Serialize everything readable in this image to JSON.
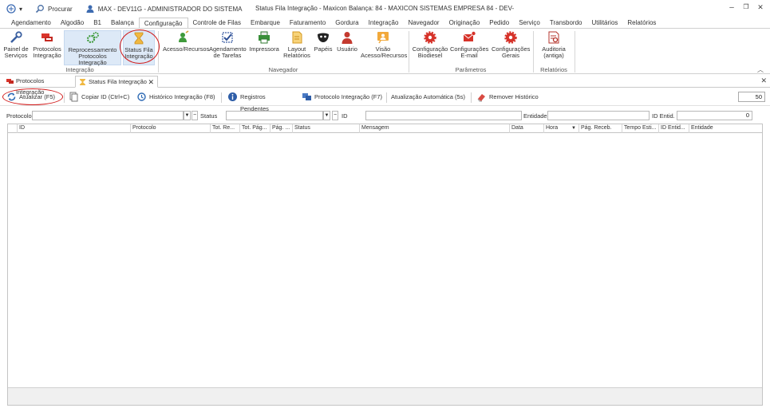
{
  "titlebar": {
    "search_label": "Procurar",
    "user_label": "MAX - DEV11G - ADMINISTRADOR DO SISTEMA",
    "window_title": "Status Fila Integração - Maxicon Balança: 84 - MAXICON SISTEMAS EMPRESA 84 - DEV-",
    "minimize": "–",
    "restore": "❐",
    "close": "✕"
  },
  "menu": {
    "tabs": [
      "Agendamento",
      "Algodão",
      "B1",
      "Balança",
      "Configuração",
      "Controle de Filas",
      "Embarque",
      "Faturamento",
      "Gordura",
      "Integração",
      "Navegador",
      "Originação",
      "Pedido",
      "Serviço",
      "Transbordo",
      "Utilitários",
      "Relatórios"
    ]
  },
  "ribbon": {
    "painel_servicos": [
      "Painel de",
      "Serviços"
    ],
    "protocolos_integracao": [
      "Protocolos",
      "Integração"
    ],
    "reprocessamento": [
      "Reprocessamento",
      "Protocolos Integração"
    ],
    "status_fila": [
      "Status Fila",
      "Integração"
    ],
    "acesso_recursos": [
      "Acesso/Recursos",
      ""
    ],
    "agendamento_tarefas": [
      "Agendamento",
      "de Tarefas"
    ],
    "impressora": [
      "Impressora",
      ""
    ],
    "layout_relatorios": [
      "Layout",
      "Relatórios"
    ],
    "papeis": [
      "Papéis",
      ""
    ],
    "usuario": [
      "Usuário",
      ""
    ],
    "visao_acesso": [
      "Visão",
      "Acesso/Recursos"
    ],
    "config_biodiesel": [
      "Configuração",
      "Biodiesel"
    ],
    "config_email": [
      "Configurações",
      "E-mail"
    ],
    "config_gerais": [
      "Configurações",
      "Gerais"
    ],
    "auditoria": [
      "Auditoria",
      "(antiga)"
    ],
    "groups": {
      "integracao": "Integração",
      "navegador": "Navegador",
      "parametros": "Parâmetros",
      "relatorios": "Relatórios"
    }
  },
  "doctabs": {
    "tab1": "Protocolos Integração",
    "tab2": "Status Fila Integração",
    "close": "✕"
  },
  "toolbar": {
    "atualizar": "Atualizar (F5)",
    "copiar_id": "Copiar ID (Ctrl+C)",
    "historico": "Histórico Integração (F8)",
    "registros_pendentes": "Registros Pendentes",
    "protocolo_integracao": "Protocolo Integração (F7)",
    "atualizacao_automatica": "Atualização Automática (5s)",
    "remover_historico": "Remover Histórico",
    "limit_value": "50"
  },
  "filters": {
    "protocolo_label": "Protocolo",
    "status_label": "Status",
    "id_label": "ID",
    "entidade_label": "Entidade",
    "id_entid_label": "ID Entid.",
    "id_entid_value": "0"
  },
  "grid": {
    "columns": [
      "ID",
      "Protocolo",
      "Tot. Re...",
      "Tot. Pág...",
      "Pág. ...",
      "Status",
      "Mensagem",
      "Data",
      "Hora",
      "Pág. Receb.",
      "Tempo Esti...",
      "ID Entid...",
      "Entidade"
    ]
  },
  "colors": {
    "accent_selected": "#dde9f7",
    "annotation": "#d01818",
    "active_menu_text": "#333333"
  }
}
